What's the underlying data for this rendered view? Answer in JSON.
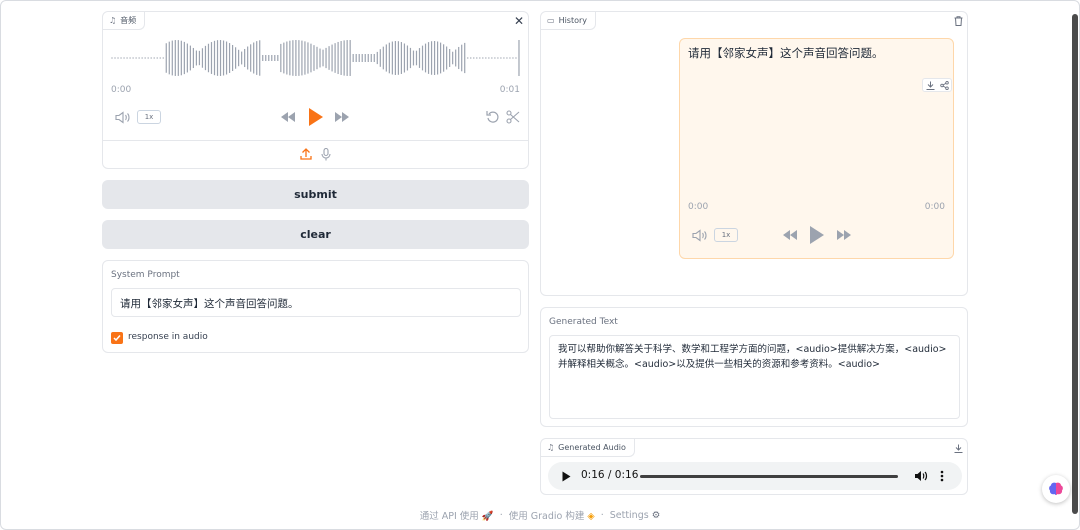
{
  "audio_input": {
    "tag_label": "音频",
    "time_start": "0:00",
    "time_end": "0:01",
    "rate": "1x"
  },
  "buttons": {
    "submit": "submit",
    "clear": "clear"
  },
  "system_prompt": {
    "label": "System Prompt",
    "value": "请用【邻家女声】这个声音回答问题。",
    "checkbox_label": "response in audio",
    "checked": true
  },
  "history": {
    "tag_label": "History",
    "message": "请用【邻家女声】这个声音回答问题。",
    "time_start": "0:00",
    "time_end": "0:00",
    "rate": "1x"
  },
  "generated_text": {
    "label": "Generated Text",
    "value": "我可以帮助你解答关于科学、数学和工程学方面的问题，<audio>提供解决方案，<audio>并解释相关概念。<audio>以及提供一些相关的资源和参考资料。<audio>"
  },
  "generated_audio": {
    "tag_label": "Generated Audio",
    "time": "0:16 / 0:16"
  },
  "footer": {
    "api": "通过 API 使用",
    "built": "使用 Gradio 构建",
    "settings": "Settings"
  },
  "colors": {
    "accent": "#f97316",
    "button_bg": "#e5e7eb",
    "chat_bg": "#fff7ed"
  }
}
